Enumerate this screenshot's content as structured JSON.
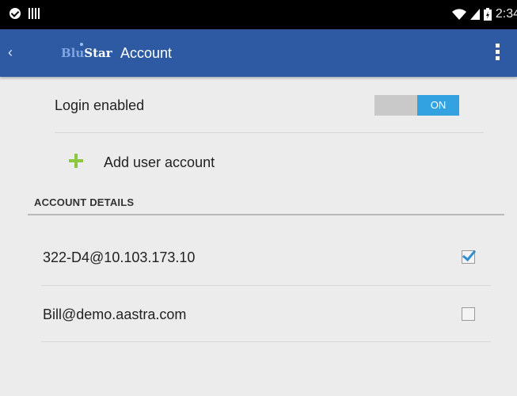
{
  "status_bar": {
    "time": "2:34"
  },
  "action_bar": {
    "logo_part1": "Blu",
    "logo_part2": "Star",
    "title": "Account"
  },
  "settings": {
    "login_label": "Login enabled",
    "login_toggle": {
      "state_label": "ON",
      "value": true
    },
    "add_account_label": "Add user account"
  },
  "account_details": {
    "header": "ACCOUNT DETAILS",
    "accounts": [
      {
        "address": "322-D4@10.103.173.10",
        "checked": true
      },
      {
        "address": "Bill@demo.aastra.com",
        "checked": false
      }
    ]
  },
  "colors": {
    "action_bar": "#2d5aa3",
    "toggle_on": "#33a2e0",
    "add_icon": "#8dc63f",
    "checkbox_tick": "#2e8fd0"
  },
  "icons": [
    "check-circle-icon",
    "barcode-icon",
    "wifi-icon",
    "signal-icon",
    "battery-icon",
    "back-chevron-icon",
    "overflow-menu-icon",
    "plus-icon",
    "checkbox-icon"
  ]
}
